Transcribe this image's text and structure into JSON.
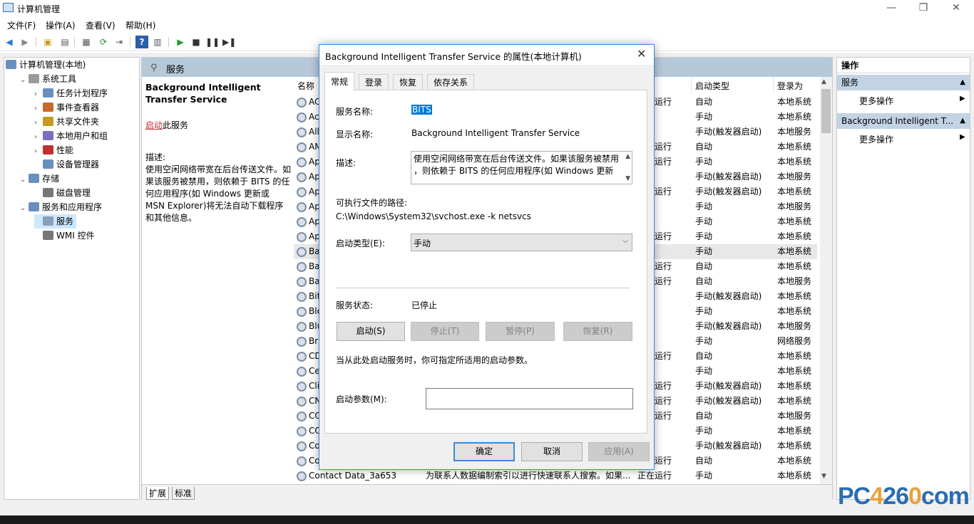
{
  "window": {
    "title": "计算机管理",
    "minimize": "—",
    "restore": "❐",
    "close": "✕"
  },
  "menu": [
    "文件(F)",
    "操作(A)",
    "查看(V)",
    "帮助(H)"
  ],
  "toolbar": [
    "back-icon",
    "forward-icon",
    "up-icon",
    "show-hide-tree-icon",
    "properties-icon",
    "refresh-icon",
    "export-icon",
    "help-icon",
    "show-hide-action-icon",
    "play-icon",
    "stop-icon",
    "pause-icon",
    "restart-icon"
  ],
  "tree": [
    {
      "label": "计算机管理(本地)",
      "icon": "computer-icon",
      "indent": 0,
      "exp": ""
    },
    {
      "label": "系统工具",
      "icon": "tools-icon",
      "indent": 1,
      "exp": "v"
    },
    {
      "label": "任务计划程序",
      "icon": "task-scheduler-icon",
      "indent": 2,
      "exp": ">"
    },
    {
      "label": "事件查看器",
      "icon": "event-viewer-icon",
      "indent": 2,
      "exp": ">"
    },
    {
      "label": "共享文件夹",
      "icon": "shared-folder-icon",
      "indent": 2,
      "exp": ">"
    },
    {
      "label": "本地用户和组",
      "icon": "users-icon",
      "indent": 2,
      "exp": ">"
    },
    {
      "label": "性能",
      "icon": "performance-icon",
      "indent": 2,
      "exp": ">"
    },
    {
      "label": "设备管理器",
      "icon": "device-manager-icon",
      "indent": 2,
      "exp": ""
    },
    {
      "label": "存储",
      "icon": "storage-icon",
      "indent": 1,
      "exp": "v"
    },
    {
      "label": "磁盘管理",
      "icon": "disk-icon",
      "indent": 2,
      "exp": ""
    },
    {
      "label": "服务和应用程序",
      "icon": "services-apps-icon",
      "indent": 1,
      "exp": "v"
    },
    {
      "label": "服务",
      "icon": "services-icon",
      "indent": 2,
      "exp": ""
    },
    {
      "label": "WMI 控件",
      "icon": "wmi-icon",
      "indent": 2,
      "exp": ""
    }
  ],
  "middle": {
    "header": "服务",
    "desc_title": "Background Intelligent Transfer Service",
    "start_link": "启动",
    "start_suffix": "此服务",
    "desc_label": "描述:",
    "desc_text": "使用空闲网络带宽在后台传送文件。如果该服务被禁用，则依赖于 BITS 的任何应用程序(如 Windows 更新或 MSN Explorer)将无法自动下载程序和其他信息。",
    "columns": {
      "name": "名称",
      "startup": "启动类型",
      "logon": "登录为"
    },
    "rows": [
      {
        "name": "AC",
        "status": "运行",
        "startup": "自动",
        "logon": "本地系统"
      },
      {
        "name": "Ac",
        "status": "",
        "startup": "手动",
        "logon": "本地系统"
      },
      {
        "name": "All",
        "status": "",
        "startup": "手动(触发器启动)",
        "logon": "本地服务"
      },
      {
        "name": "AM",
        "status": "运行",
        "startup": "自动",
        "logon": "本地系统"
      },
      {
        "name": "Ap",
        "status": "运行",
        "startup": "手动",
        "logon": "本地系统"
      },
      {
        "name": "Ap",
        "status": "",
        "startup": "手动(触发器启动)",
        "logon": "本地服务"
      },
      {
        "name": "Ap",
        "status": "运行",
        "startup": "手动(触发器启动)",
        "logon": "本地系统"
      },
      {
        "name": "Ap",
        "status": "",
        "startup": "手动",
        "logon": "本地服务"
      },
      {
        "name": "Ap",
        "status": "",
        "startup": "手动",
        "logon": "本地系统"
      },
      {
        "name": "Ap",
        "status": "运行",
        "startup": "手动",
        "logon": "本地系统"
      },
      {
        "name": "Ba",
        "status": "",
        "startup": "手动",
        "logon": "本地系统"
      },
      {
        "name": "Ba",
        "status": "运行",
        "startup": "自动",
        "logon": "本地系统"
      },
      {
        "name": "Ba",
        "status": "运行",
        "startup": "自动",
        "logon": "本地服务"
      },
      {
        "name": "Bit",
        "status": "",
        "startup": "手动(触发器启动)",
        "logon": "本地系统"
      },
      {
        "name": "Blo",
        "status": "",
        "startup": "手动",
        "logon": "本地系统"
      },
      {
        "name": "Blu",
        "status": "",
        "startup": "手动(触发器启动)",
        "logon": "本地服务"
      },
      {
        "name": "Br",
        "status": "",
        "startup": "手动",
        "logon": "网络服务"
      },
      {
        "name": "CD",
        "status": "运行",
        "startup": "自动",
        "logon": "本地系统"
      },
      {
        "name": "Ce",
        "status": "",
        "startup": "手动",
        "logon": "本地系统"
      },
      {
        "name": "Cli",
        "status": "运行",
        "startup": "手动(触发器启动)",
        "logon": "本地系统"
      },
      {
        "name": "CN",
        "status": "运行",
        "startup": "手动(触发器启动)",
        "logon": "本地系统"
      },
      {
        "name": "CO",
        "status": "运行",
        "startup": "自动",
        "logon": "本地服务"
      },
      {
        "name": "CO",
        "status": "",
        "startup": "手动",
        "logon": "本地系统"
      },
      {
        "name": "Co",
        "status": "",
        "startup": "手动(触发器启动)",
        "logon": "本地系统"
      },
      {
        "name": "Co",
        "status": "运行",
        "startup": "自动",
        "logon": "本地系统"
      },
      {
        "name": "Contact Data_3a653",
        "desc": "为联系人数据编制索引以进行快速联系人搜索。如果...",
        "status": "正在运行",
        "startup": "手动",
        "logon": "本地系统"
      }
    ],
    "tab_extended": "扩展",
    "tab_standard": "标准"
  },
  "actions": {
    "title": "操作",
    "section1": "服务",
    "more1": "更多操作",
    "section2": "Background Intelligent T...",
    "more2": "更多操作"
  },
  "dialog": {
    "title": "Background Intelligent Transfer Service 的属性(本地计算机)",
    "tabs": [
      "常规",
      "登录",
      "恢复",
      "依存关系"
    ],
    "service_name_label": "服务名称:",
    "service_name": "BITS",
    "display_name_label": "显示名称:",
    "display_name": "Background Intelligent Transfer Service",
    "desc_label": "描述:",
    "desc_line1": "使用空闲网络带宽在后台传送文件。如果该服务被禁用",
    "desc_line2": "，则依赖于 BITS 的任何应用程序(如 Windows 更新",
    "path_label": "可执行文件的路径:",
    "path": "C:\\Windows\\System32\\svchost.exe -k netsvcs",
    "startup_label": "启动类型(E):",
    "startup_value": "手动",
    "status_label": "服务状态:",
    "status_value": "已停止",
    "btn_start": "启动(S)",
    "btn_stop": "停止(T)",
    "btn_pause": "暂停(P)",
    "btn_resume": "恢复(R)",
    "hint": "当从此处启动服务时，你可指定所适用的启动参数。",
    "param_label": "启动参数(M):",
    "param_value": "",
    "ok": "确定",
    "cancel": "取消",
    "apply": "应用(A)"
  },
  "watermark": "PC4260com"
}
